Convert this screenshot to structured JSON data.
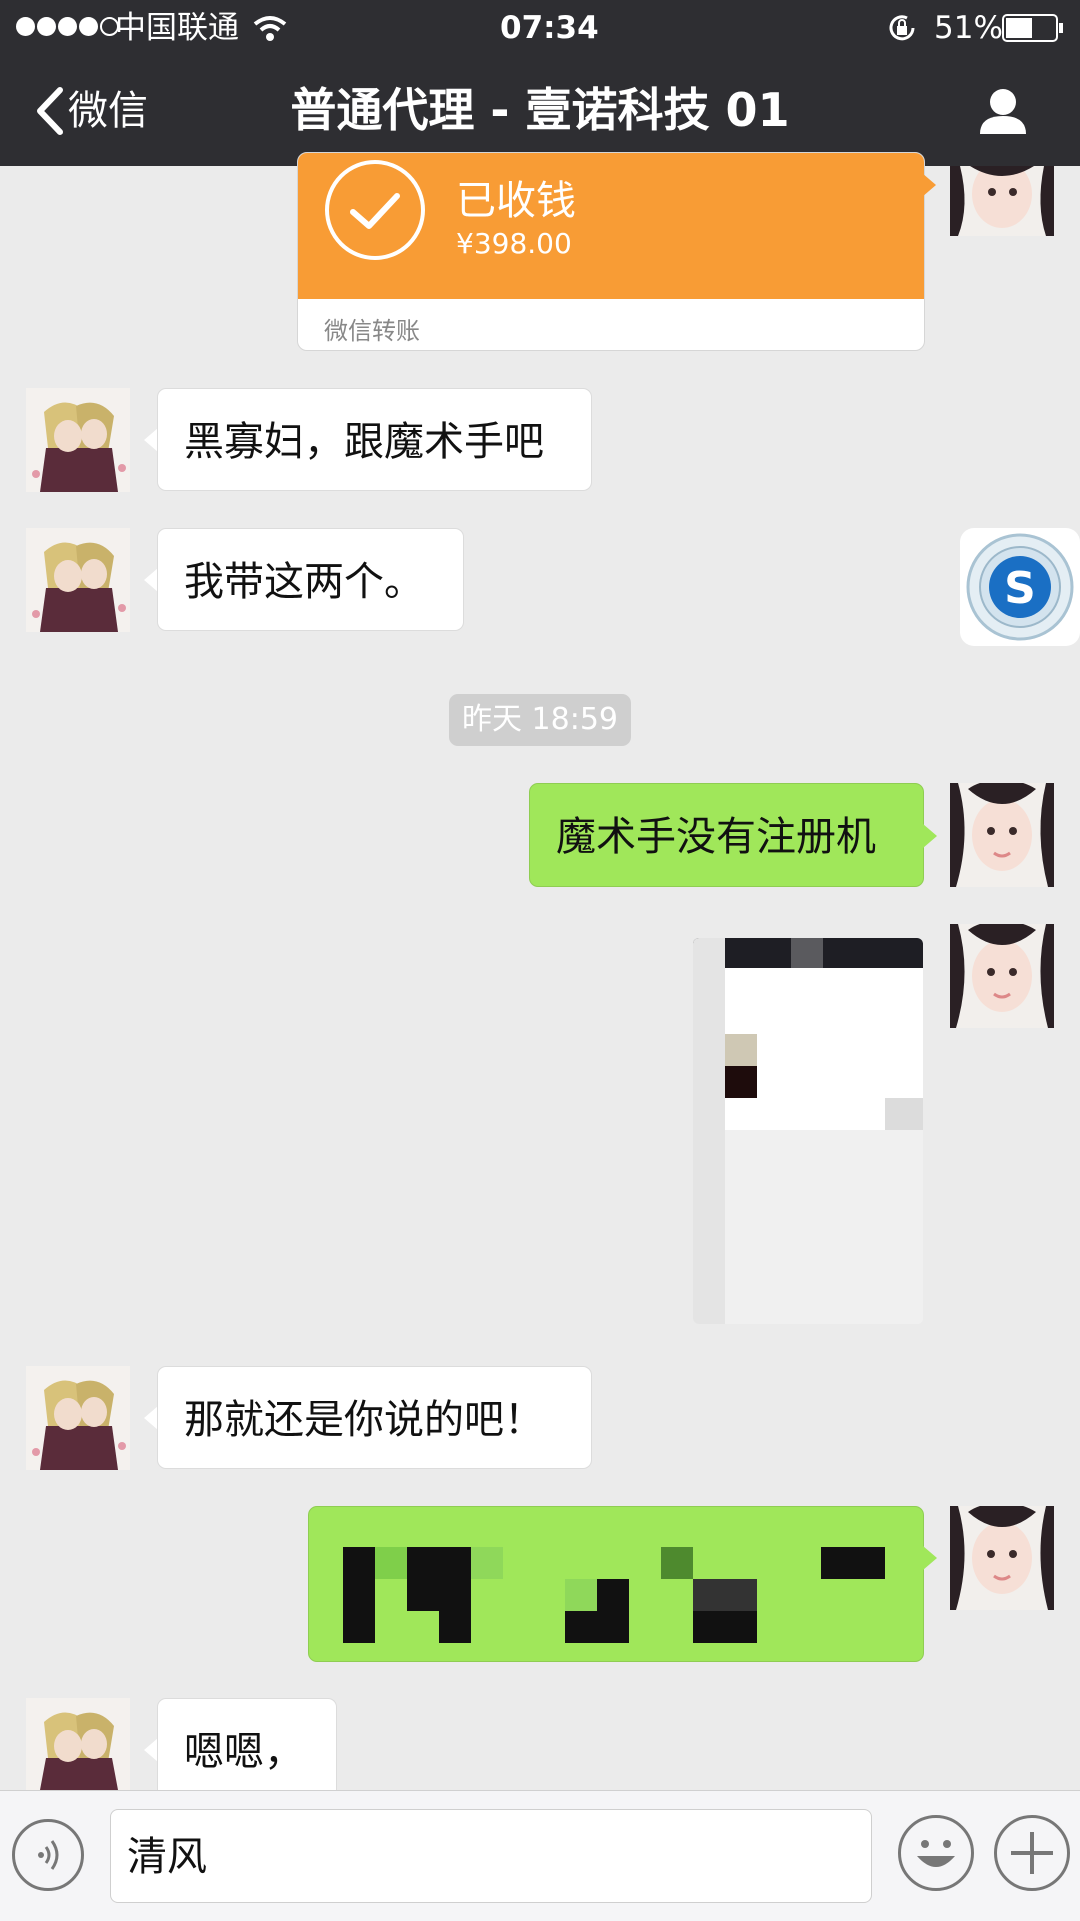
{
  "status_bar": {
    "carrier": "中国联通",
    "time": "07:34",
    "battery": "51%"
  },
  "nav": {
    "back_label": "微信",
    "title": "普通代理 - 壹诺科技  01"
  },
  "transfer": {
    "status": "已收钱",
    "amount": "¥398.00",
    "footer": "微信转账"
  },
  "messages": {
    "m1": "黑寡妇，跟魔术手吧",
    "m2": "我带这两个。",
    "timestamp": "昨天 18:59",
    "m3": "魔术手没有注册机",
    "m4": "那就还是你说的吧！",
    "m5": "嗯嗯，"
  },
  "input": {
    "value": "清风"
  },
  "colors": {
    "nav_bg": "#2e2e32",
    "chat_bg": "#ebebeb",
    "outgoing_bubble": "#a0e75a",
    "transfer_orange": "#f89c35"
  },
  "icons": [
    "back-chevron-icon",
    "wifi-icon",
    "rotation-lock-icon",
    "battery-icon",
    "profile-icon",
    "voice-icon",
    "emoji-icon",
    "plus-icon",
    "sogou-s-icon"
  ]
}
